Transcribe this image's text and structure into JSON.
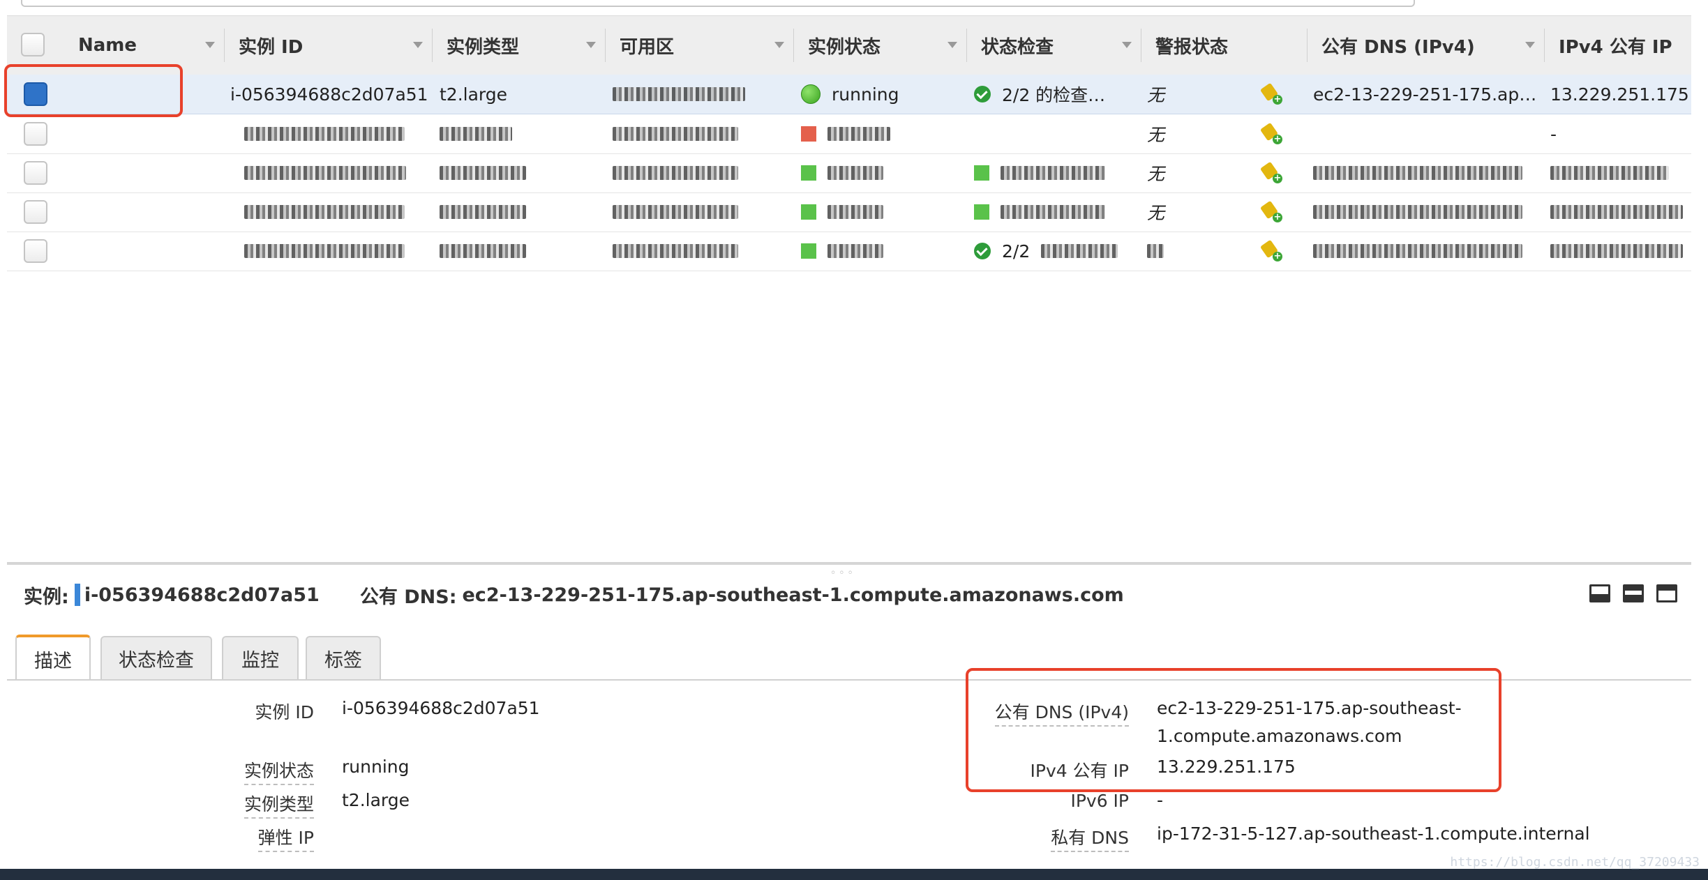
{
  "table": {
    "columns": [
      {
        "label": "Name"
      },
      {
        "label": "实例 ID"
      },
      {
        "label": "实例类型"
      },
      {
        "label": "可用区"
      },
      {
        "label": "实例状态"
      },
      {
        "label": "状态检查"
      },
      {
        "label": "警报状态"
      },
      {
        "label": "公有 DNS (IPv4)"
      },
      {
        "label": "IPv4 公有 IP"
      }
    ],
    "selected_row": {
      "instance_id": "i-056394688c2d07a51",
      "instance_type": "t2.large",
      "state": "running",
      "status_check": "2/2 的检查…",
      "alarm_status": "无",
      "public_dns": "ec2-13-229-251-175.ap…",
      "public_ip": "13.229.251.175"
    },
    "other_rows": [
      {
        "alarm_status": "无",
        "public_ip": "-",
        "check_text": ""
      },
      {
        "alarm_status": "无",
        "public_ip": "",
        "check_text": ""
      },
      {
        "alarm_status": "无",
        "public_ip": "",
        "check_text": ""
      },
      {
        "alarm_status": "",
        "public_ip": "",
        "check_text": "2/2"
      }
    ]
  },
  "detail": {
    "instance_label": "实例:",
    "instance_id": "i-056394688c2d07a51",
    "dns_label": "公有 DNS:",
    "dns_value": "ec2-13-229-251-175.ap-southeast-1.compute.amazonaws.com",
    "tabs": [
      {
        "label": "描述"
      },
      {
        "label": "状态检查"
      },
      {
        "label": "监控"
      },
      {
        "label": "标签"
      }
    ],
    "left_fields": [
      {
        "label": "实例 ID",
        "value": "i-056394688c2d07a51"
      },
      {
        "label": "实例状态",
        "value": "running"
      },
      {
        "label": "实例类型",
        "value": "t2.large"
      },
      {
        "label": "弹性 IP",
        "value": ""
      }
    ],
    "right_fields": [
      {
        "label": "公有 DNS (IPv4)",
        "value_line1": "ec2-13-229-251-175.ap-southeast-",
        "value_line2": "1.compute.amazonaws.com"
      },
      {
        "label": "IPv4 公有 IP",
        "value": "13.229.251.175"
      },
      {
        "label": "IPv6 IP",
        "value": "-"
      },
      {
        "label": "私有 DNS",
        "value": "ip-172-31-5-127.ap-southeast-1.compute.internal"
      }
    ]
  },
  "watermark": "https://blog.csdn.net/qq_37209433",
  "colors": {
    "highlight": "#e8412b",
    "selected_row": "#e6eef8",
    "accent_tab": "#f09a2a",
    "checkbox_checked": "#2f73c8"
  }
}
